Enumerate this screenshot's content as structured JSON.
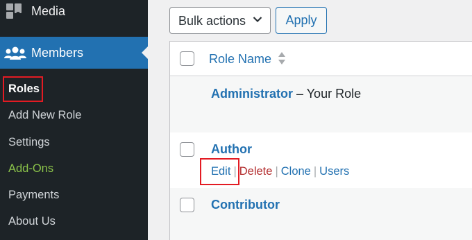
{
  "sidebar": {
    "media_label": "Media",
    "members_label": "Members",
    "submenu": [
      "Roles",
      "Add New Role",
      "Settings",
      "Add-Ons",
      "Payments",
      "About Us"
    ]
  },
  "toolbar": {
    "bulk_actions": "Bulk actions",
    "apply": "Apply"
  },
  "table": {
    "header": "Role Name",
    "rows": [
      {
        "name": "Administrator",
        "suffix": " – Your Role"
      },
      {
        "name": "Author",
        "actions": [
          "Edit",
          "Delete",
          "Clone",
          "Users"
        ]
      },
      {
        "name": "Contributor"
      }
    ]
  },
  "colors": {
    "sidebar_bg": "#1d2327",
    "accent": "#2271b1",
    "highlight": "#e31b23",
    "addons": "#8bc34a",
    "delete": "#b32d2e"
  },
  "icons": [
    "media-icon",
    "members-icon",
    "chevron-down-icon",
    "sort-icon"
  ]
}
